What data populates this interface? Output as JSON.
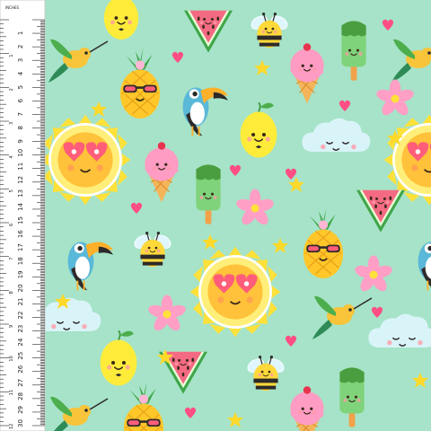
{
  "background_color": "#a6e3c8",
  "ruler": {
    "unit_label": "INCHES",
    "cm_numbers": [
      "1",
      "2",
      "3",
      "4",
      "5",
      "6",
      "7",
      "8",
      "9",
      "10",
      "11",
      "12",
      "13",
      "14",
      "15",
      "16",
      "17",
      "18",
      "19",
      "20",
      "21",
      "22",
      "23",
      "24",
      "25",
      "26",
      "27",
      "28",
      "29",
      "30"
    ],
    "inch_numbers": [
      "1",
      "2",
      "3",
      "4",
      "5",
      "6",
      "7",
      "8",
      "9",
      "10",
      "11",
      "12"
    ]
  },
  "motifs": [
    "sun",
    "pineapple",
    "watermelon",
    "bee",
    "ice-cream",
    "popsicle",
    "hummingbird",
    "toucan",
    "lemon",
    "cloud",
    "plumeria-flower",
    "heart",
    "star"
  ],
  "colors": {
    "sun": "#ffe13a",
    "watermelon": "#f56a83",
    "pineapple": "#ffd22a",
    "leaf": "#4cae4c",
    "toucan_body": "#5ab8d8",
    "flower": "#ff9fc6",
    "cloud": "#d9f4f8"
  }
}
